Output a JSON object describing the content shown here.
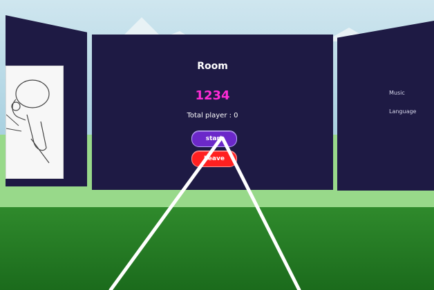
{
  "room_panel": {
    "title": "Room",
    "room_code": "1234",
    "total_player_text": "Total player : 0",
    "start_label": "start",
    "leave_label": "Leave"
  },
  "settings_panel": {
    "music_label": "Music",
    "language_label": "Language"
  },
  "colors": {
    "panel_bg": "#1e1a44",
    "room_code": "#ff2bd6",
    "start_button": "#6b28c9",
    "leave_button": "#ff2020",
    "laser": "#ffffff",
    "ground_near": "#1b6b1c",
    "ground_far": "#98d98a"
  }
}
